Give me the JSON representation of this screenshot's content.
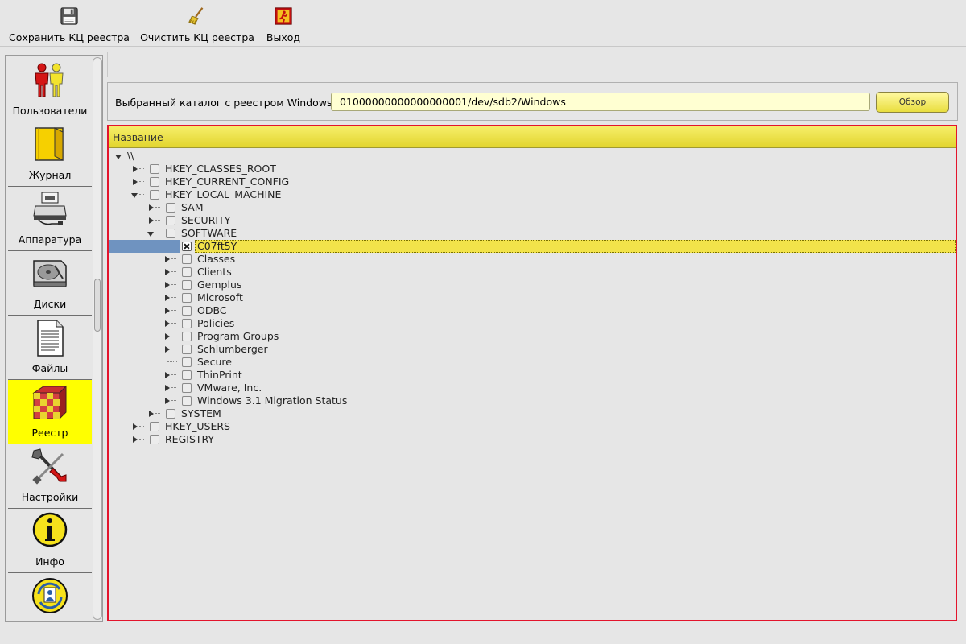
{
  "toolbar": {
    "save_label": "Сохранить КЦ реестра",
    "clear_label": "Очистить КЦ реестра",
    "exit_label": "Выход"
  },
  "nav": {
    "items": [
      {
        "label": "Пользователи",
        "icon": "users-icon"
      },
      {
        "label": "Журнал",
        "icon": "journal-icon"
      },
      {
        "label": "Аппаратура",
        "icon": "hardware-icon"
      },
      {
        "label": "Диски",
        "icon": "disk-icon"
      },
      {
        "label": "Файлы",
        "icon": "file-icon"
      },
      {
        "label": "Реестр",
        "icon": "registry-icon",
        "active": true
      },
      {
        "label": "Настройки",
        "icon": "settings-icon"
      },
      {
        "label": "Инфо",
        "icon": "info-icon"
      },
      {
        "label": "",
        "icon": "update-icon"
      }
    ]
  },
  "directory": {
    "label": "Выбранный каталог с реестром Windows:",
    "value": "01000000000000000001/dev/sdb2/Windows",
    "browse_label": "Обзор"
  },
  "tree": {
    "header": "Название",
    "rows": [
      {
        "label": "\\\\",
        "level": 0,
        "state": "open",
        "checkbox": false
      },
      {
        "label": "HKEY_CLASSES_ROOT",
        "level": 1,
        "state": "closed",
        "checkbox": true
      },
      {
        "label": "HKEY_CURRENT_CONFIG",
        "level": 1,
        "state": "closed",
        "checkbox": true
      },
      {
        "label": "HKEY_LOCAL_MACHINE",
        "level": 1,
        "state": "open",
        "checkbox": true
      },
      {
        "label": "SAM",
        "level": 2,
        "state": "closed",
        "checkbox": true
      },
      {
        "label": "SECURITY",
        "level": 2,
        "state": "closed",
        "checkbox": true
      },
      {
        "label": "SOFTWARE",
        "level": 2,
        "state": "open",
        "checkbox": true
      },
      {
        "label": "C07ft5Y",
        "level": 3,
        "state": "leaf",
        "checkbox": true,
        "checked": true,
        "selected": true
      },
      {
        "label": "Classes",
        "level": 3,
        "state": "closed",
        "checkbox": true
      },
      {
        "label": "Clients",
        "level": 3,
        "state": "closed",
        "checkbox": true
      },
      {
        "label": "Gemplus",
        "level": 3,
        "state": "closed",
        "checkbox": true
      },
      {
        "label": "Microsoft",
        "level": 3,
        "state": "closed",
        "checkbox": true
      },
      {
        "label": "ODBC",
        "level": 3,
        "state": "closed",
        "checkbox": true
      },
      {
        "label": "Policies",
        "level": 3,
        "state": "closed",
        "checkbox": true
      },
      {
        "label": "Program Groups",
        "level": 3,
        "state": "closed",
        "checkbox": true
      },
      {
        "label": "Schlumberger",
        "level": 3,
        "state": "closed",
        "checkbox": true
      },
      {
        "label": "Secure",
        "level": 3,
        "state": "leaf",
        "checkbox": true
      },
      {
        "label": "ThinPrint",
        "level": 3,
        "state": "closed",
        "checkbox": true
      },
      {
        "label": "VMware, Inc.",
        "level": 3,
        "state": "closed",
        "checkbox": true
      },
      {
        "label": "Windows 3.1 Migration Status",
        "level": 3,
        "state": "closed",
        "checkbox": true
      },
      {
        "label": "SYSTEM",
        "level": 2,
        "state": "closed",
        "checkbox": true
      },
      {
        "label": "HKEY_USERS",
        "level": 1,
        "state": "closed",
        "checkbox": true
      },
      {
        "label": "REGISTRY",
        "level": 1,
        "state": "closed",
        "checkbox": true
      }
    ]
  },
  "colors": {
    "active_nav": "#ffff00",
    "tree_border": "#e3142c",
    "header_yellow": "#e9dc3a",
    "selection_blue": "#6f93c0"
  }
}
